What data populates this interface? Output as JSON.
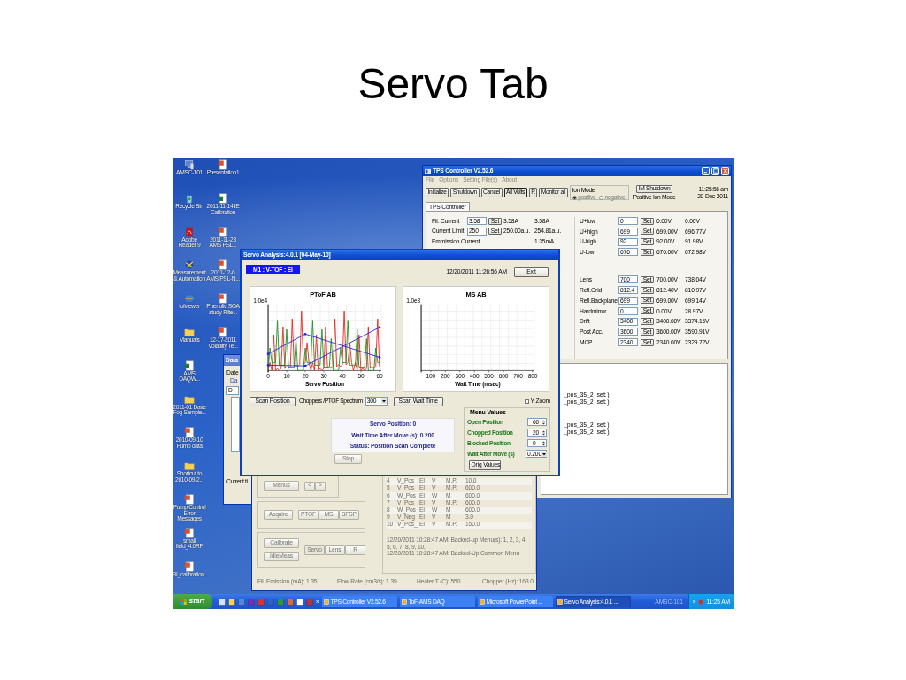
{
  "slide": {
    "title": "Servo Tab"
  },
  "desktop_icons": [
    {
      "label": "AMSC-101",
      "kind": "computer"
    },
    {
      "label": "Recycle Bin",
      "kind": "recycle"
    },
    {
      "label": "Adobe Reader 9",
      "kind": "pdf"
    },
    {
      "label": "Measurement & Automation",
      "kind": "globe"
    },
    {
      "label": "tofviewer",
      "kind": "app"
    },
    {
      "label": "Manuals",
      "kind": "folder"
    },
    {
      "label": "AMS DAQW...",
      "kind": "excel"
    },
    {
      "label": "2011-01 Dave Fog Sample...",
      "kind": "folder"
    },
    {
      "label": "2010-09-10 Pump data",
      "kind": "ppt"
    },
    {
      "label": "Shortcut to 2010-09-2...",
      "kind": "folder"
    },
    {
      "label": "Pump Control Error Messages",
      "kind": "ppt"
    },
    {
      "label": "small field_4.0RF",
      "kind": "ppt"
    },
    {
      "label": "BI_calibration...",
      "kind": "ppt"
    },
    {
      "label": "Presentation1",
      "kind": "ppt"
    },
    {
      "label": "2011-11-14 IE Calibration",
      "kind": "excel"
    },
    {
      "label": "2011-11-23 AMS PSL...",
      "kind": "ppt"
    },
    {
      "label": "2011-12-6 AMS PSL-N...",
      "kind": "ppt"
    },
    {
      "label": "Phenolic SOA study-Filte...",
      "kind": "ppt"
    },
    {
      "label": "12-17-2011 Volatility Te...",
      "kind": "ppt"
    }
  ],
  "tps_window": {
    "title": "TPS Controller V2.52.6",
    "menu": [
      "File",
      "Options",
      "Setting File(s)",
      "About"
    ],
    "toolbar": [
      {
        "label": "Initialize",
        "pressed": false
      },
      {
        "label": "Shutdown",
        "pressed": false
      },
      {
        "label": "Cancel",
        "pressed": false
      },
      {
        "label": "All Volts",
        "pressed": true
      },
      {
        "label": "R",
        "pressed": false
      },
      {
        "label": "Monitor all",
        "pressed": false
      }
    ],
    "ion_mode": {
      "label": "Ion Mode",
      "options": [
        {
          "label": "positive",
          "selected": true
        },
        {
          "label": "negative",
          "selected": false
        }
      ]
    },
    "shutdown_button": "IM Shutdown",
    "mode_status": "Positive Ion Mode",
    "time": "11:25:56 am",
    "date": "20-Dec-2011",
    "tab": "TPS Controller",
    "current_rows": [
      {
        "kind": "setting",
        "label": "Fil. Current",
        "value": "3.58",
        "button": "Set",
        "setpoint": "3.58A",
        "reading": "3.58A"
      },
      {
        "kind": "setting",
        "label": "Current Limit",
        "value": "250",
        "button": "Set",
        "setpoint": "250.00a.u.",
        "reading": "254.81a.u."
      },
      {
        "kind": "reading",
        "label": "Emmission Current",
        "reading": "1.35mA"
      }
    ],
    "voltage_groups": [
      [
        {
          "label": "U+low",
          "value": "0",
          "button": "Set",
          "setpoint": "0.00V",
          "reading": "0.00V"
        },
        {
          "label": "U+high",
          "value": "699",
          "button": "Set",
          "setpoint": "699.00V",
          "reading": "696.77V"
        },
        {
          "label": "U-high",
          "value": "92",
          "button": "Set",
          "setpoint": "92.00V",
          "reading": "91.98V"
        },
        {
          "label": "U-low",
          "value": "676",
          "button": "Set",
          "setpoint": "676.00V",
          "reading": "672.98V"
        }
      ],
      [
        {
          "label": "Lens",
          "value": "700",
          "button": "Set",
          "setpoint": "700.00V",
          "reading": "738.04V"
        },
        {
          "label": "Refl.Grid",
          "value": "812.4",
          "button": "Set",
          "setpoint": "812.40V",
          "reading": "810.97V"
        },
        {
          "label": "Refl.Backplane",
          "value": "699",
          "button": "Set",
          "setpoint": "699.00V",
          "reading": "699.14V"
        },
        {
          "label": "Hardmirror",
          "value": "0",
          "button": "Set",
          "setpoint": "0.00V",
          "reading": "28.97V"
        },
        {
          "label": "Drift",
          "value": "3400",
          "button": "Set",
          "setpoint": "3400.00V",
          "reading": "3374.15V"
        },
        {
          "label": "Post Acc.",
          "value": "3600",
          "button": "Set",
          "setpoint": "3600.00V",
          "reading": "3590.91V"
        },
        {
          "label": "MCP",
          "value": "2340",
          "button": "Set",
          "setpoint": "2340.00V",
          "reading": "2329.72V"
        }
      ]
    ],
    "log_blocks": [
      [
        "_pos_35_2.set)",
        "_pos_35_2.set)"
      ],
      [
        "_pos_35_2.set)",
        "_pos_35_2.set)"
      ]
    ]
  },
  "data_window": {
    "title": "Data",
    "date_label": "Date",
    "group_label": "Da",
    "field_text": "D",
    "footer": "Current ti"
  },
  "daq_window": {
    "menus_button": "Menus",
    "nav_buttons": [
      "<",
      ">"
    ],
    "acquire_button": "Acquire",
    "modes": [
      {
        "label": "PTOF",
        "selected": false
      },
      {
        "label": "MS",
        "selected": false
      },
      {
        "label": "BFSP",
        "selected": false
      }
    ],
    "calibrate_button": "Calibrate",
    "idle_button": "IdleMeas",
    "tools": [
      {
        "label": "Servo",
        "selected": true
      },
      {
        "label": "Lens",
        "selected": false
      },
      {
        "label": "R",
        "selected": false
      }
    ],
    "menu_rows": [
      [
        "4",
        "V_Pos",
        "EI",
        "V",
        "M.P.",
        "10.0"
      ],
      [
        "5",
        "V_Pos_",
        "EI",
        "V",
        "M.P.",
        "600.0"
      ],
      [
        "6",
        "W_Pos",
        "EI",
        "W",
        "M",
        "600.0"
      ],
      [
        "7",
        "V_Pos_",
        "EI",
        "V",
        "M.P.",
        "600.0"
      ],
      [
        "8",
        "W_Pos",
        "EI",
        "W",
        "M",
        "600.0"
      ],
      [
        "9",
        "V_Neg",
        "EI",
        "V",
        "M",
        "3.0"
      ],
      [
        "10",
        "V_Pos_",
        "EI",
        "V",
        "M.P.",
        "150.0"
      ]
    ],
    "log": [
      "12/20/2011 10:28:47 AM: Backed-up Menu(s): 1, 2, 3, 4, 5, 6, 7, 8, 9, 10,",
      "12/20/2011 10:28:47 AM: Backed-Up Common Menu"
    ],
    "status": [
      "Fil. Emission (mA): 1.35",
      "Flow Rate (cm3/s): 1.39",
      "Heater T (C): 550",
      "Chopper (Hz): 163.0"
    ]
  },
  "servo_window": {
    "title": "Servo Analysis:4.0.1 [04-May-10]",
    "badge": "M1 : V-TOF : EI",
    "timestamp": "12/20/2011 11:26:56 AM",
    "exit_button": "Exit",
    "charts": [
      {
        "kind": "traces",
        "title": "PToF AB",
        "y_label": "1.0e4",
        "x_ticks": [
          "0",
          "10",
          "20",
          "30",
          "40",
          "50",
          "60"
        ],
        "x_label": "Servo Position"
      },
      {
        "kind": "empty",
        "title": "MS AB",
        "y_label": "1.0e3",
        "x_ticks": [
          "100",
          "200",
          "300",
          "400",
          "500",
          "600",
          "700",
          "800"
        ],
        "x_label": "Wait Time (msec)"
      }
    ],
    "scan_position_button": "Scan Position",
    "spectrum_label": "Choppers /PTOF Spectrum",
    "spectrum_value": "300",
    "scan_wait_button": "Scan Wait Time",
    "y_zoom": {
      "label": "Y Zoom",
      "checked": false
    },
    "status_lines": [
      "Servo Position: 0",
      "Wait Time After Move (s): 0.200",
      "Status: Position Scan Complete"
    ],
    "stop_button": {
      "label": "Stop",
      "disabled": true
    },
    "menu_values": {
      "title": "Menu Values",
      "fields": [
        {
          "kind": "spinner",
          "label": "Open Position",
          "value": "60"
        },
        {
          "kind": "spinner",
          "label": "Chopped Position",
          "value": "20"
        },
        {
          "kind": "spinner",
          "label": "Blocked Position",
          "value": "0"
        },
        {
          "kind": "dropdown",
          "label": "Wait After Move (s)",
          "value": "0.200"
        }
      ],
      "button": "Orig Values"
    }
  },
  "taskbar": {
    "start": "start",
    "quick_launch_more": "»",
    "tasks": [
      {
        "label": "TPS Controller V2.52.6",
        "selected": false
      },
      {
        "label": "ToF-AMS DAQ",
        "selected": false
      },
      {
        "label": "Microsoft PowerPoint ...",
        "selected": false
      },
      {
        "label": "Servo Analysis:4.0.1 ...",
        "selected": true
      }
    ],
    "tray_label": "AMSC-101",
    "tray_more": "»",
    "clock": "11:25 AM"
  }
}
